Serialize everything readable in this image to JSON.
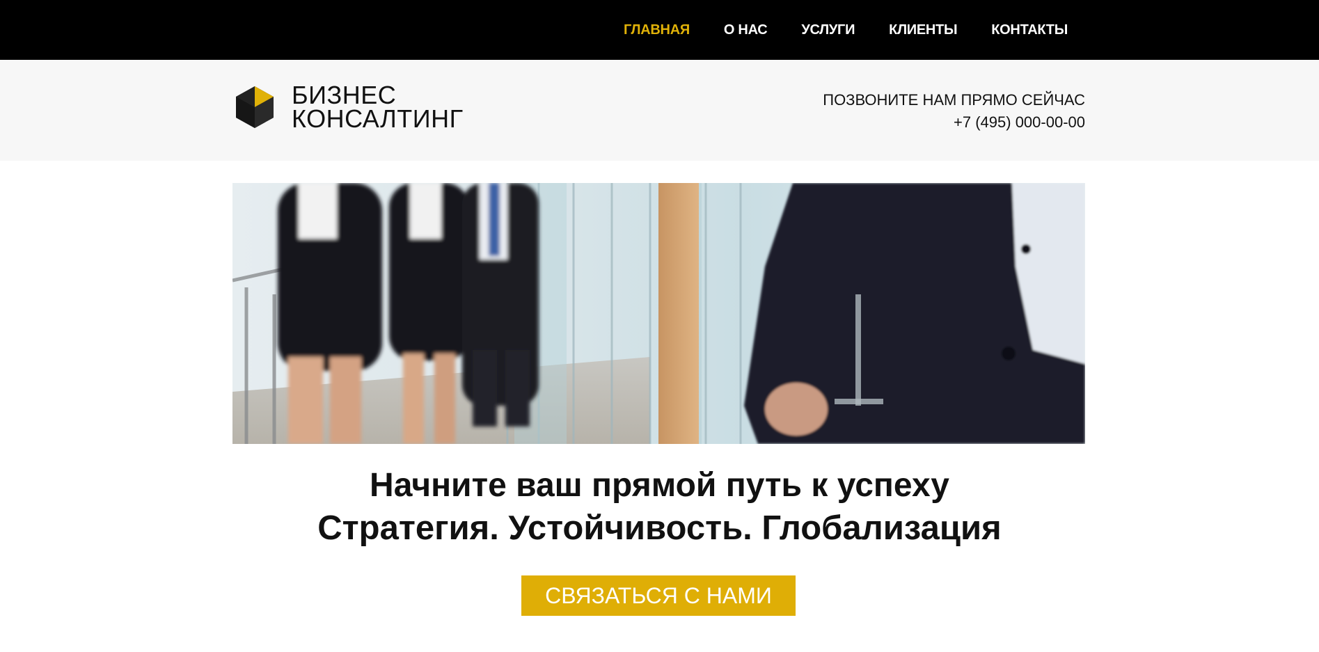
{
  "nav": {
    "items": [
      {
        "label": "ГЛАВНАЯ",
        "active": true
      },
      {
        "label": "О НАС"
      },
      {
        "label": "УСЛУГИ"
      },
      {
        "label": "КЛИЕНТЫ"
      },
      {
        "label": "КОНТАКТЫ"
      }
    ]
  },
  "brand": {
    "line1": "БИЗНЕС",
    "line2": "КОНСАЛТИНГ",
    "logo_icon": "cube-logo-icon",
    "accent_color": "#e0b108"
  },
  "contact": {
    "prompt": "ПОЗВОНИТЕ НАМ ПРЯМО СЕЙЧАС",
    "phone": "+7 (495) 000-00-00"
  },
  "hero": {
    "tagline": "Начните ваш прямой путь к успеху",
    "subline": "Стратегия. Устойчивость. Глобализация",
    "cta_label": "СВЯЗАТЬСЯ С НАМИ",
    "cta_color": "#dfae06"
  }
}
